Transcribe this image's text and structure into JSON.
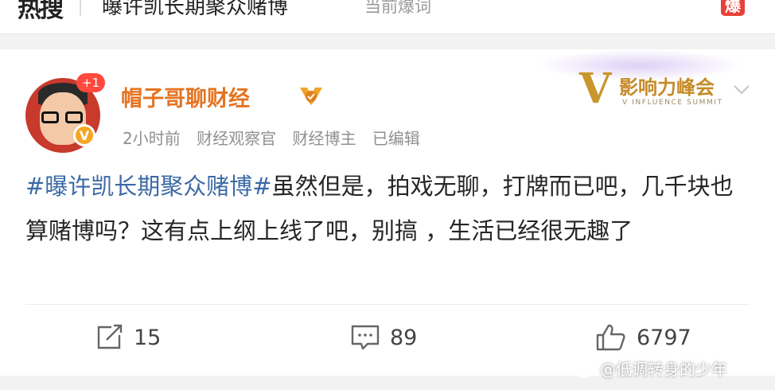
{
  "hot_header": {
    "logo": "热搜",
    "title": "曝许凯长期聚众赌博",
    "subtitle": "当前爆词",
    "badge": "爆"
  },
  "post": {
    "author": "帽子哥聊财经",
    "avatar_badge": "+1",
    "verified_mark": "V",
    "meta": [
      "2小时前",
      "财经观察官",
      "财经博主",
      "已编辑"
    ],
    "summit_logo": {
      "mark": "V",
      "cn": "影响力峰会",
      "en": "V INFLUENCE SUMMIT"
    },
    "hashtag": "#曝许凯长期聚众赌博#",
    "text": "虽然但是，拍戏无聊，打牌而已吧，几千块也算赌博吗？这有点上纲上线了吧，别搞 ，生活已经很无趣了"
  },
  "actions": {
    "repost_count": "15",
    "comment_count": "89",
    "like_count": "6797"
  },
  "watermark": "@低调转身的少年",
  "colors": {
    "author": "#e5731f",
    "hashtag": "#3c6aa6",
    "badge": "#e8403a",
    "summit_gold": "#c9962b"
  }
}
